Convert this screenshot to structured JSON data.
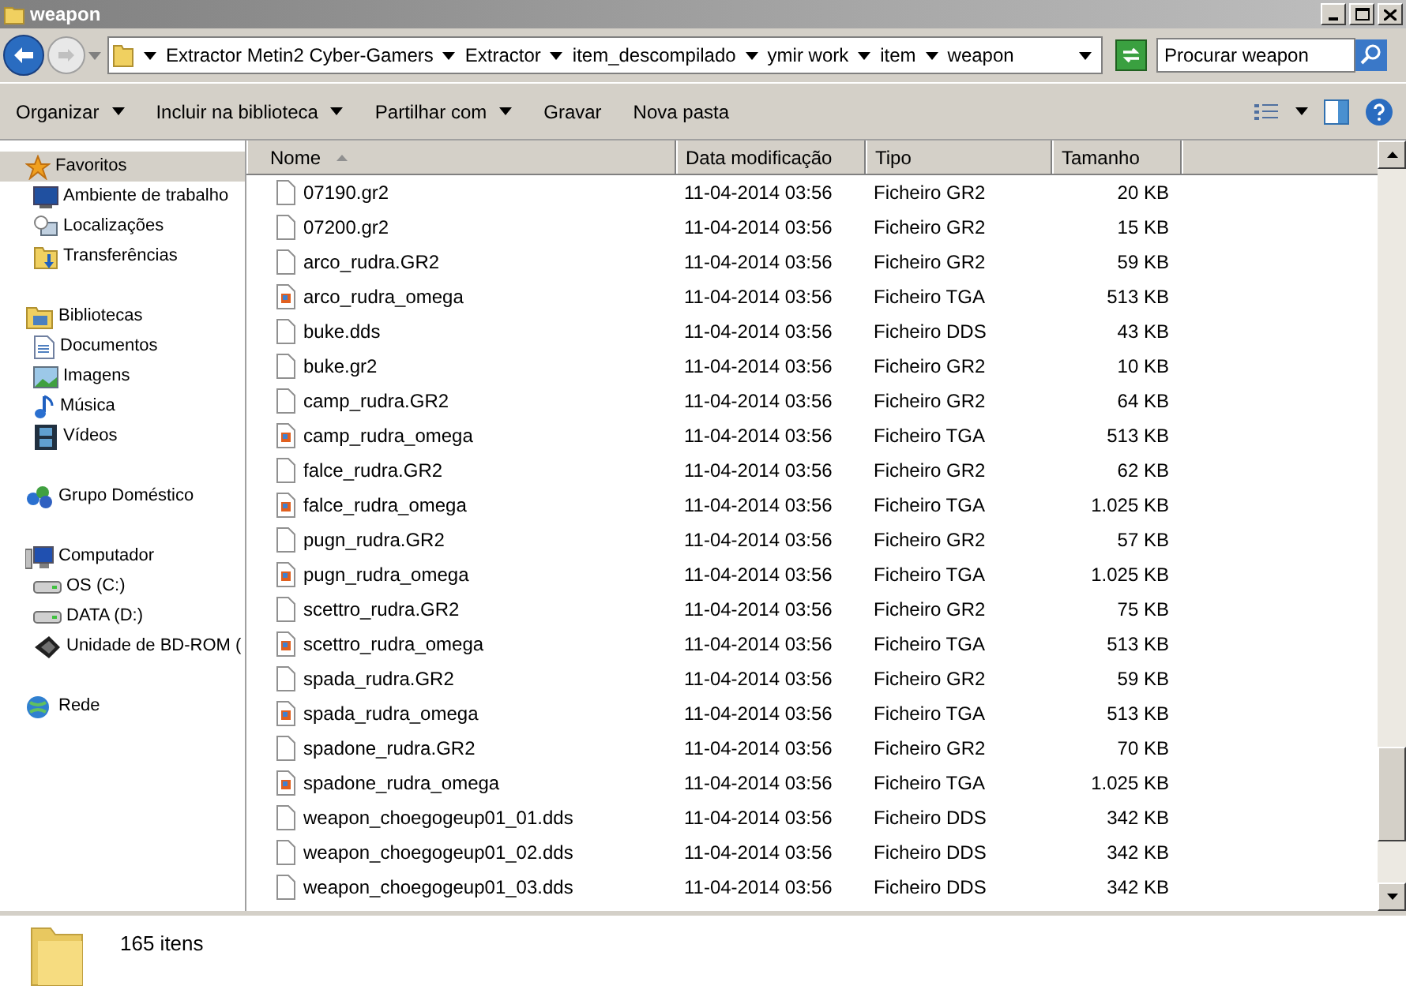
{
  "window": {
    "title": "weapon"
  },
  "breadcrumbs": [
    "Extractor Metin2 Cyber-Gamers",
    "Extractor",
    "item_descompilado",
    "ymir work",
    "item",
    "weapon"
  ],
  "search": {
    "placeholder": "Procurar weapon"
  },
  "toolbar": [
    {
      "label": "Organizar",
      "dropdown": true
    },
    {
      "label": "Incluir na biblioteca",
      "dropdown": true
    },
    {
      "label": "Partilhar com",
      "dropdown": true
    },
    {
      "label": "Gravar",
      "dropdown": false
    },
    {
      "label": "Nova pasta",
      "dropdown": false
    }
  ],
  "sidebar": {
    "groups": [
      {
        "label": "Favoritos",
        "kind": "star",
        "selected": true,
        "children": [
          {
            "label": "Ambiente de trabalho",
            "kind": "desktop",
            "selected": false
          },
          {
            "label": "Localizações",
            "kind": "places",
            "selected": false
          },
          {
            "label": "Transferências",
            "kind": "download",
            "selected": false
          }
        ]
      },
      {
        "label": "Bibliotecas",
        "kind": "library",
        "selected": false,
        "children": [
          {
            "label": "Documentos",
            "kind": "doc",
            "selected": false
          },
          {
            "label": "Imagens",
            "kind": "image",
            "selected": false
          },
          {
            "label": "Música",
            "kind": "music",
            "selected": false
          },
          {
            "label": "Vídeos",
            "kind": "video",
            "selected": false
          }
        ]
      },
      {
        "label": "Grupo Doméstico",
        "kind": "homegroup",
        "selected": false
      },
      {
        "label": "Computador",
        "kind": "computer",
        "selected": false,
        "children": [
          {
            "label": "OS (C:)",
            "kind": "drive",
            "selected": false
          },
          {
            "label": "DATA (D:)",
            "kind": "drive",
            "selected": false
          },
          {
            "label": "Unidade de BD-ROM (",
            "kind": "disc",
            "selected": false
          }
        ]
      },
      {
        "label": "Rede",
        "kind": "network",
        "selected": false
      }
    ]
  },
  "table": {
    "columns": [
      "Nome",
      "Data modificação",
      "Tipo",
      "Tamanho"
    ],
    "rows": [
      {
        "kind": "file",
        "name": "07190.gr2",
        "date": "11-04-2014 03:56",
        "type": "Ficheiro GR2",
        "size": "20 KB"
      },
      {
        "kind": "file",
        "name": "07200.gr2",
        "date": "11-04-2014 03:56",
        "type": "Ficheiro GR2",
        "size": "15 KB"
      },
      {
        "kind": "file",
        "name": "arco_rudra.GR2",
        "date": "11-04-2014 03:56",
        "type": "Ficheiro GR2",
        "size": "59 KB"
      },
      {
        "kind": "image",
        "name": "arco_rudra_omega",
        "date": "11-04-2014 03:56",
        "type": "Ficheiro TGA",
        "size": "513 KB"
      },
      {
        "kind": "file",
        "name": "buke.dds",
        "date": "11-04-2014 03:56",
        "type": "Ficheiro DDS",
        "size": "43 KB"
      },
      {
        "kind": "file",
        "name": "buke.gr2",
        "date": "11-04-2014 03:56",
        "type": "Ficheiro GR2",
        "size": "10 KB"
      },
      {
        "kind": "file",
        "name": "camp_rudra.GR2",
        "date": "11-04-2014 03:56",
        "type": "Ficheiro GR2",
        "size": "64 KB"
      },
      {
        "kind": "image",
        "name": "camp_rudra_omega",
        "date": "11-04-2014 03:56",
        "type": "Ficheiro TGA",
        "size": "513 KB"
      },
      {
        "kind": "file",
        "name": "falce_rudra.GR2",
        "date": "11-04-2014 03:56",
        "type": "Ficheiro GR2",
        "size": "62 KB"
      },
      {
        "kind": "image",
        "name": "falce_rudra_omega",
        "date": "11-04-2014 03:56",
        "type": "Ficheiro TGA",
        "size": "1.025 KB"
      },
      {
        "kind": "file",
        "name": "pugn_rudra.GR2",
        "date": "11-04-2014 03:56",
        "type": "Ficheiro GR2",
        "size": "57 KB"
      },
      {
        "kind": "image",
        "name": "pugn_rudra_omega",
        "date": "11-04-2014 03:56",
        "type": "Ficheiro TGA",
        "size": "1.025 KB"
      },
      {
        "kind": "file",
        "name": "scettro_rudra.GR2",
        "date": "11-04-2014 03:56",
        "type": "Ficheiro GR2",
        "size": "75 KB"
      },
      {
        "kind": "image",
        "name": "scettro_rudra_omega",
        "date": "11-04-2014 03:56",
        "type": "Ficheiro TGA",
        "size": "513 KB"
      },
      {
        "kind": "file",
        "name": "spada_rudra.GR2",
        "date": "11-04-2014 03:56",
        "type": "Ficheiro GR2",
        "size": "59 KB"
      },
      {
        "kind": "image",
        "name": "spada_rudra_omega",
        "date": "11-04-2014 03:56",
        "type": "Ficheiro TGA",
        "size": "513 KB"
      },
      {
        "kind": "file",
        "name": "spadone_rudra.GR2",
        "date": "11-04-2014 03:56",
        "type": "Ficheiro GR2",
        "size": "70 KB"
      },
      {
        "kind": "image",
        "name": "spadone_rudra_omega",
        "date": "11-04-2014 03:56",
        "type": "Ficheiro TGA",
        "size": "1.025 KB"
      },
      {
        "kind": "file",
        "name": "weapon_choegogeup01_01.dds",
        "date": "11-04-2014 03:56",
        "type": "Ficheiro DDS",
        "size": "342 KB"
      },
      {
        "kind": "file",
        "name": "weapon_choegogeup01_02.dds",
        "date": "11-04-2014 03:56",
        "type": "Ficheiro DDS",
        "size": "342 KB"
      },
      {
        "kind": "file",
        "name": "weapon_choegogeup01_03.dds",
        "date": "11-04-2014 03:56",
        "type": "Ficheiro DDS",
        "size": "342 KB"
      }
    ]
  },
  "status_bar": {
    "count": "165 itens"
  }
}
